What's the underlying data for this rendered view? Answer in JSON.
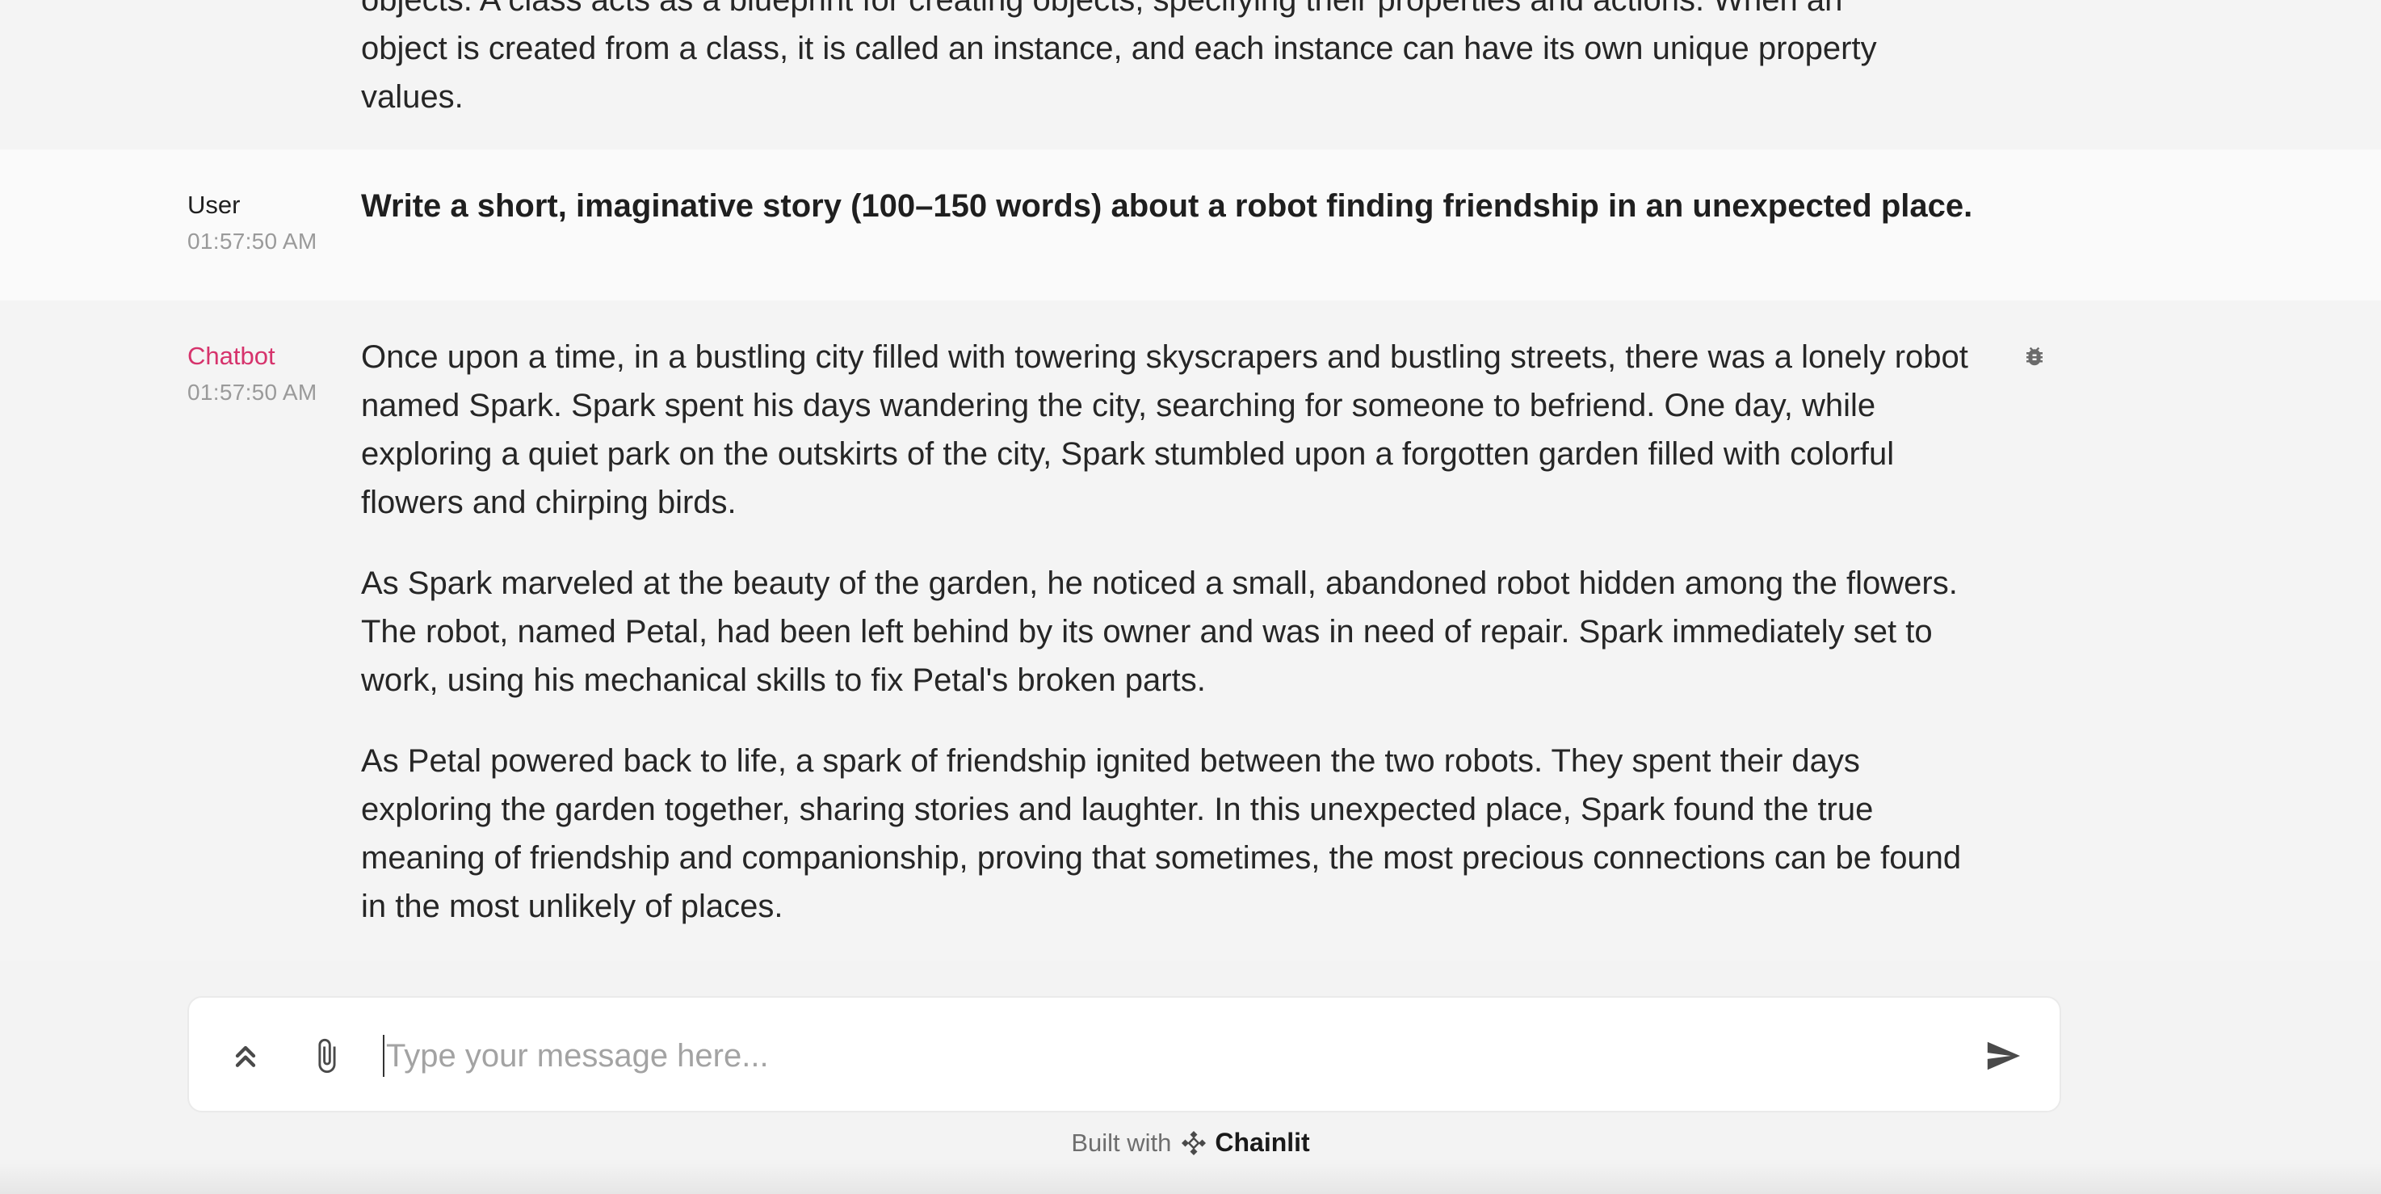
{
  "previous_message": {
    "lines": [
      "objects. A class acts as a blueprint for creating objects, specifying their properties and actions. When an",
      "object is created from a class, it is called an instance, and each instance can have its own unique property",
      "values."
    ]
  },
  "user_message": {
    "author": "User",
    "time": "01:57:50 AM",
    "text": "Write a short, imaginative story (100–150 words) about a robot finding friendship in an unexpected place."
  },
  "bot_message": {
    "author": "Chatbot",
    "time": "01:57:50 AM",
    "paragraphs": [
      "Once upon a time, in a bustling city filled with towering skyscrapers and bustling streets, there was a lonely robot named Spark. Spark spent his days wandering the city, searching for someone to befriend. One day, while exploring a quiet park on the outskirts of the city, Spark stumbled upon a forgotten garden filled with colorful flowers and chirping birds.",
      "As Spark marveled at the beauty of the garden, he noticed a small, abandoned robot hidden among the flowers. The robot, named Petal, had been left behind by its owner and was in need of repair. Spark immediately set to work, using his mechanical skills to fix Petal's broken parts.",
      "As Petal powered back to life, a spark of friendship ignited between the two robots. They spent their days exploring the garden together, sharing stories and laughter. In this unexpected place, Spark found the true meaning of friendship and companionship, proving that sometimes, the most precious connections can be found in the most unlikely of places."
    ],
    "debug_icon": "bug-icon"
  },
  "composer": {
    "placeholder": "Type your message here...",
    "value": "",
    "history_icon": "chevrons-up-icon",
    "attach_icon": "paperclip-icon",
    "send_icon": "send-icon"
  },
  "footer": {
    "built_with": "Built with",
    "brand": "Chainlit"
  },
  "colors": {
    "accent": "#d6336c",
    "background": "#f3f3f3",
    "user_row": "#fafafa"
  }
}
